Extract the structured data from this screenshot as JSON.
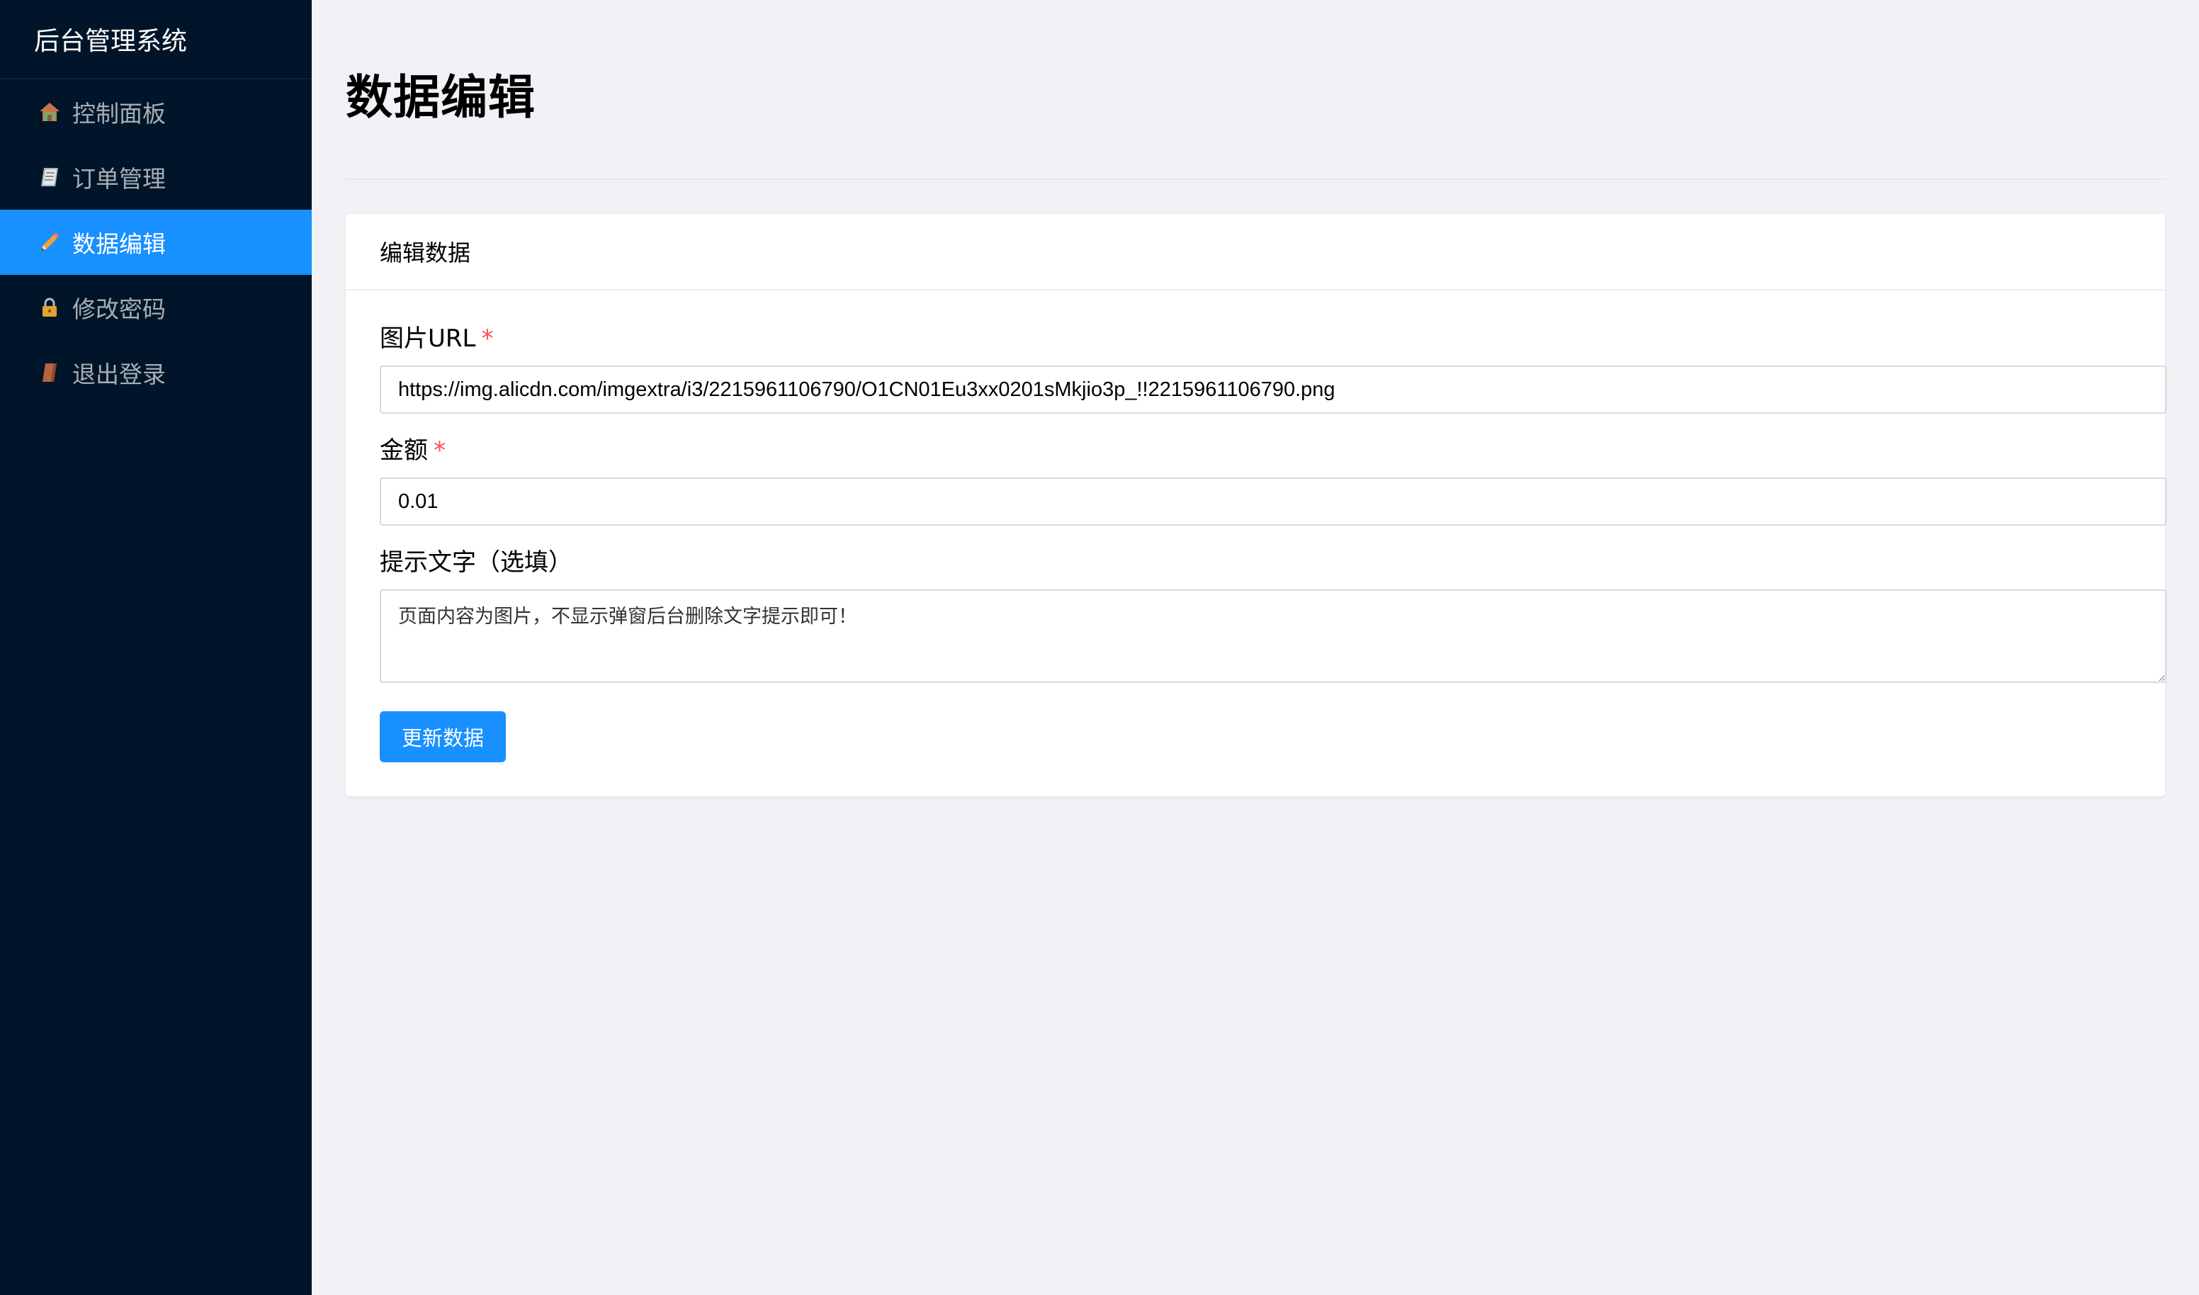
{
  "sidebar": {
    "title": "后台管理系统",
    "items": [
      {
        "icon": "house-icon",
        "label": "控制面板",
        "active": false
      },
      {
        "icon": "notebook-icon",
        "label": "订单管理",
        "active": false
      },
      {
        "icon": "pencil-icon",
        "label": "数据编辑",
        "active": true
      },
      {
        "icon": "lock-icon",
        "label": "修改密码",
        "active": false
      },
      {
        "icon": "book-icon",
        "label": "退出登录",
        "active": false
      }
    ]
  },
  "main": {
    "page_title": "数据编辑",
    "card_title": "编辑数据",
    "fields": {
      "image_url": {
        "label": "图片URL",
        "required_mark": "*",
        "value": "https://img.alicdn.com/imgextra/i3/2215961106790/O1CN01Eu3xx0201sMkjio3p_!!2215961106790.png"
      },
      "amount": {
        "label": "金额",
        "required_mark": "*",
        "value": "0.01"
      },
      "hint_text": {
        "label": "提示文字（选填）",
        "value": "页面内容为图片，不显示弹窗后台删除文字提示即可！"
      }
    },
    "submit_label": "更新数据"
  },
  "colors": {
    "sidebar_bg": "#001529",
    "accent": "#1890ff",
    "required": "#ff4d4f",
    "page_bg": "#f0f2f5"
  }
}
